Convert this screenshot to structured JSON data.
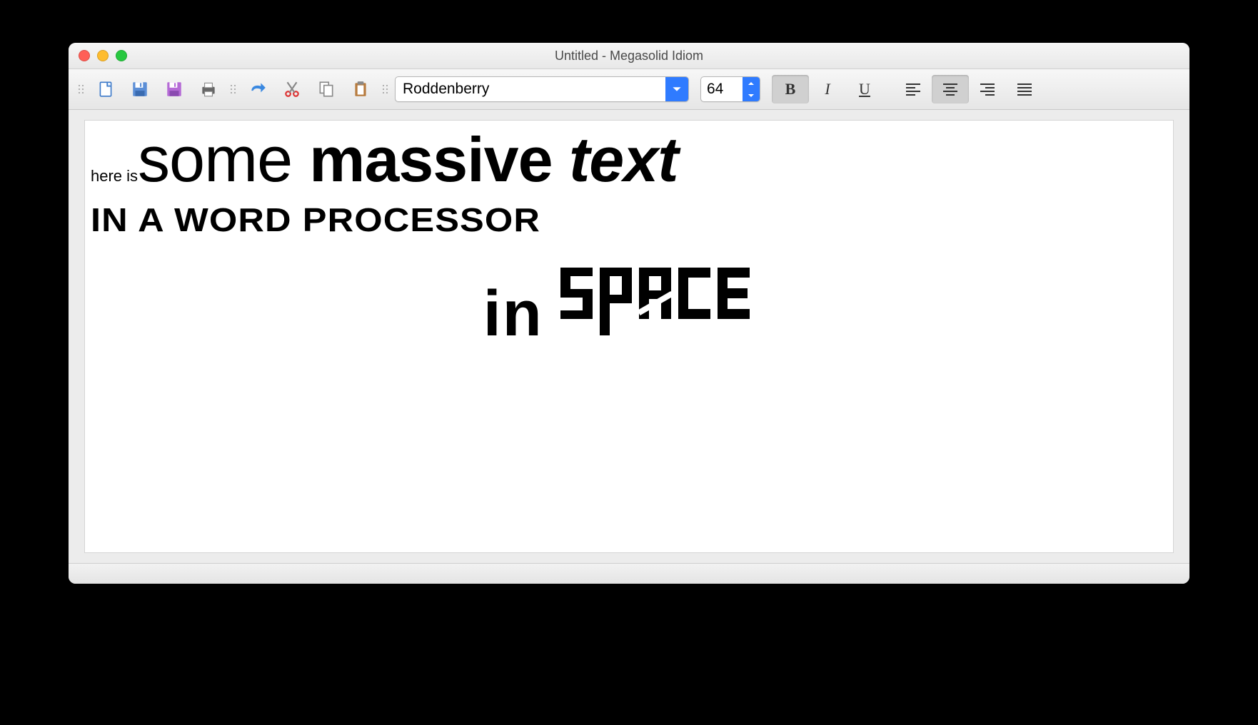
{
  "window": {
    "title": "Untitled - Megasolid Idiom"
  },
  "toolbar": {
    "font_name": "Roddenberry",
    "font_size": "64",
    "bold_label": "B",
    "italic_label": "I",
    "underline_label": "U",
    "bold_active": true,
    "center_active": true
  },
  "document": {
    "line1_small": "here is",
    "line1_some": "some ",
    "line1_massive": "massive ",
    "line1_text": "text",
    "line2": "IN A WORD PROCESSOR",
    "line3_in": "in"
  }
}
